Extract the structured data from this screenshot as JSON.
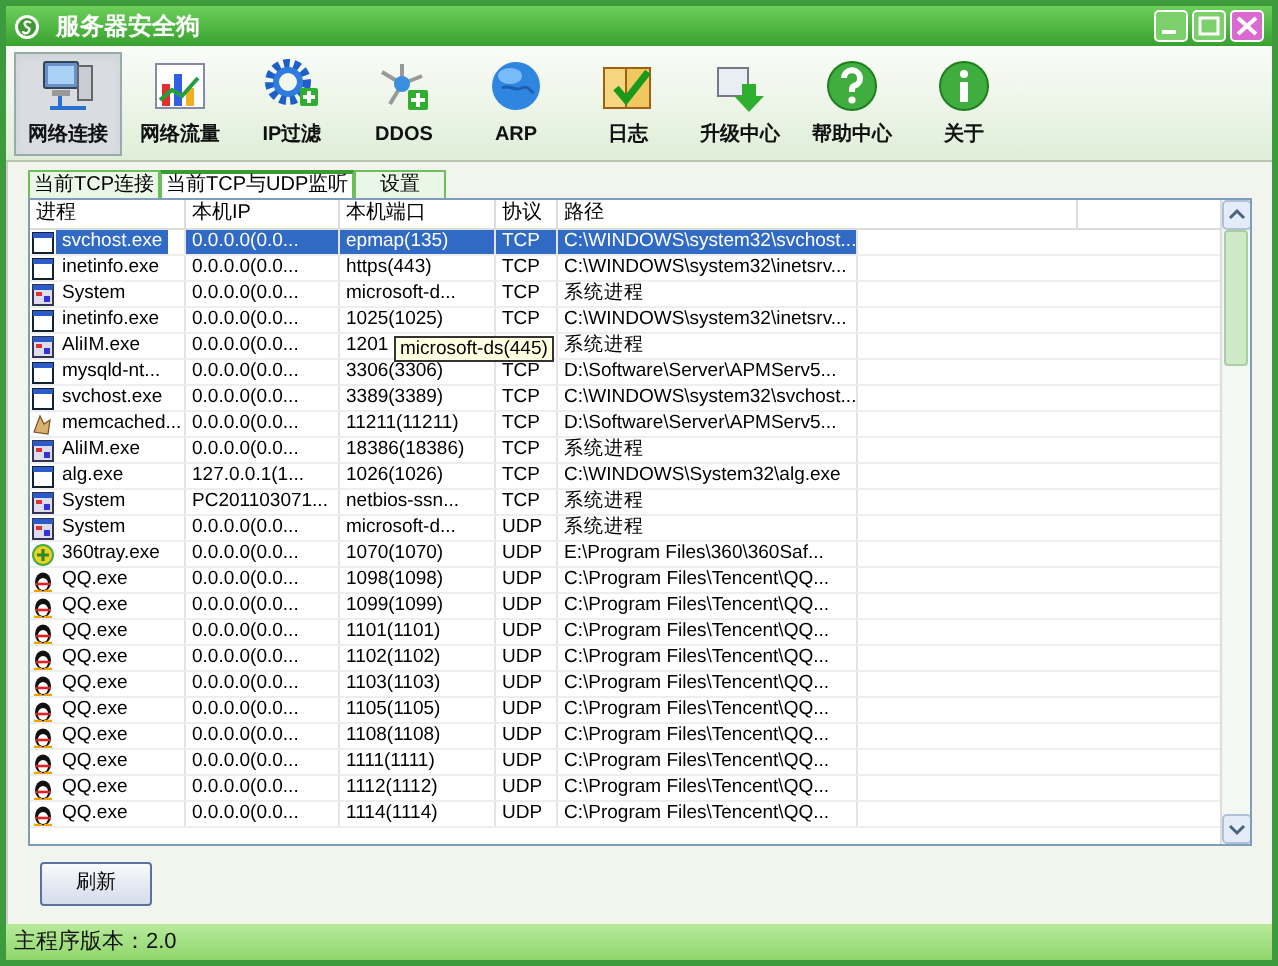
{
  "window": {
    "title": "服务器安全狗"
  },
  "toolbar": [
    {
      "label": "网络连接",
      "selected": true
    },
    {
      "label": "网络流量",
      "selected": false
    },
    {
      "label": "IP过滤",
      "selected": false
    },
    {
      "label": "DDOS",
      "selected": false
    },
    {
      "label": "ARP",
      "selected": false
    },
    {
      "label": "日志",
      "selected": false
    },
    {
      "label": "升级中心",
      "selected": false
    },
    {
      "label": "帮助中心",
      "selected": false
    },
    {
      "label": "关于",
      "selected": false
    }
  ],
  "tabs": [
    {
      "label": "当前TCP连接",
      "selected": false
    },
    {
      "label": "当前TCP与UDP监听",
      "selected": true
    },
    {
      "label": "设置",
      "selected": false
    }
  ],
  "table": {
    "columns": [
      "进程",
      "本机IP",
      "本机端口",
      "协议",
      "路径"
    ],
    "rows": [
      {
        "kind": "window",
        "process": "svchost.exe",
        "ip": "0.0.0.0(0.0...",
        "port": "epmap(135)",
        "protocol": "TCP",
        "path": "C:\\WINDOWS\\system32\\svchost...",
        "selected": true
      },
      {
        "kind": "window",
        "process": "inetinfo.exe",
        "ip": "0.0.0.0(0.0...",
        "port": "https(443)",
        "protocol": "TCP",
        "path": "C:\\WINDOWS\\system32\\inetsrv...",
        "selected": false
      },
      {
        "kind": "system",
        "process": "System",
        "ip": "0.0.0.0(0.0...",
        "port": "microsoft-d...",
        "protocol": "TCP",
        "path": "系统进程",
        "selected": false
      },
      {
        "kind": "window",
        "process": "inetinfo.exe",
        "ip": "0.0.0.0(0.0...",
        "port": "1025(1025)",
        "protocol": "TCP",
        "path": "C:\\WINDOWS\\system32\\inetsrv...",
        "selected": false
      },
      {
        "kind": "system",
        "process": "AliIM.exe",
        "ip": "0.0.0.0(0.0...",
        "port": "1201",
        "path": "系统进程",
        "selected": false
      },
      {
        "kind": "window",
        "process": "mysqld-nt...",
        "ip": "0.0.0.0(0.0...",
        "port": "3306(3306)",
        "protocol": "TCP",
        "path": "D:\\Software\\Server\\APMServ5...",
        "selected": false
      },
      {
        "kind": "window",
        "process": "svchost.exe",
        "ip": "0.0.0.0(0.0...",
        "port": "3389(3389)",
        "protocol": "TCP",
        "path": "C:\\WINDOWS\\system32\\svchost...",
        "selected": false
      },
      {
        "kind": "hand",
        "process": "memcached...",
        "ip": "0.0.0.0(0.0...",
        "port": "11211(11211)",
        "protocol": "TCP",
        "path": "D:\\Software\\Server\\APMServ5...",
        "selected": false
      },
      {
        "kind": "system",
        "process": "AliIM.exe",
        "ip": "0.0.0.0(0.0...",
        "port": "18386(18386)",
        "protocol": "TCP",
        "path": "系统进程",
        "selected": false
      },
      {
        "kind": "window",
        "process": "alg.exe",
        "ip": "127.0.0.1(1...",
        "port": "1026(1026)",
        "protocol": "TCP",
        "path": "C:\\WINDOWS\\System32\\alg.exe",
        "selected": false
      },
      {
        "kind": "system",
        "process": "System",
        "ip": "PC201103071...",
        "port": "netbios-ssn...",
        "protocol": "TCP",
        "path": "系统进程",
        "selected": false
      },
      {
        "kind": "system",
        "process": "System",
        "ip": "0.0.0.0(0.0...",
        "port": "microsoft-d...",
        "protocol": "UDP",
        "path": "系统进程",
        "selected": false
      },
      {
        "kind": "tray",
        "process": "360tray.exe",
        "ip": "0.0.0.0(0.0...",
        "port": "1070(1070)",
        "protocol": "UDP",
        "path": "E:\\Program Files\\360\\360Saf...",
        "selected": false
      },
      {
        "kind": "penguin",
        "process": "QQ.exe",
        "ip": "0.0.0.0(0.0...",
        "port": "1098(1098)",
        "protocol": "UDP",
        "path": "C:\\Program Files\\Tencent\\QQ...",
        "selected": false
      },
      {
        "kind": "penguin",
        "process": "QQ.exe",
        "ip": "0.0.0.0(0.0...",
        "port": "1099(1099)",
        "protocol": "UDP",
        "path": "C:\\Program Files\\Tencent\\QQ...",
        "selected": false
      },
      {
        "kind": "penguin",
        "process": "QQ.exe",
        "ip": "0.0.0.0(0.0...",
        "port": "1101(1101)",
        "protocol": "UDP",
        "path": "C:\\Program Files\\Tencent\\QQ...",
        "selected": false
      },
      {
        "kind": "penguin",
        "process": "QQ.exe",
        "ip": "0.0.0.0(0.0...",
        "port": "1102(1102)",
        "protocol": "UDP",
        "path": "C:\\Program Files\\Tencent\\QQ...",
        "selected": false
      },
      {
        "kind": "penguin",
        "process": "QQ.exe",
        "ip": "0.0.0.0(0.0...",
        "port": "1103(1103)",
        "protocol": "UDP",
        "path": "C:\\Program Files\\Tencent\\QQ...",
        "selected": false
      },
      {
        "kind": "penguin",
        "process": "QQ.exe",
        "ip": "0.0.0.0(0.0...",
        "port": "1105(1105)",
        "protocol": "UDP",
        "path": "C:\\Program Files\\Tencent\\QQ...",
        "selected": false
      },
      {
        "kind": "penguin",
        "process": "QQ.exe",
        "ip": "0.0.0.0(0.0...",
        "port": "1108(1108)",
        "protocol": "UDP",
        "path": "C:\\Program Files\\Tencent\\QQ...",
        "selected": false
      },
      {
        "kind": "penguin",
        "process": "QQ.exe",
        "ip": "0.0.0.0(0.0...",
        "port": "1111(1111)",
        "protocol": "UDP",
        "path": "C:\\Program Files\\Tencent\\QQ...",
        "selected": false
      },
      {
        "kind": "penguin",
        "process": "QQ.exe",
        "ip": "0.0.0.0(0.0...",
        "port": "1112(1112)",
        "protocol": "UDP",
        "path": "C:\\Program Files\\Tencent\\QQ...",
        "selected": false
      },
      {
        "kind": "penguin",
        "process": "QQ.exe",
        "ip": "0.0.0.0(0.0...",
        "port": "1114(1114)",
        "protocol": "UDP",
        "path": "C:\\Program Files\\Tencent\\QQ...",
        "selected": false
      }
    ],
    "tooltip": "microsoft-ds(445)"
  },
  "refresh_button": "刷新",
  "status_bar": "主程序版本：2.0"
}
